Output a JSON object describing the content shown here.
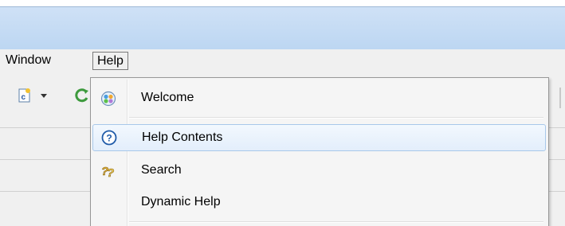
{
  "menubar": {
    "items": [
      {
        "label": "Window"
      },
      {
        "label": "Help"
      }
    ]
  },
  "help_menu": {
    "items": [
      {
        "label": "Welcome",
        "icon": "welcome-icon"
      },
      {
        "label": "Help Contents",
        "icon": "help-contents-icon",
        "highlighted": true
      },
      {
        "label": "Search",
        "icon": "search-icon"
      },
      {
        "label": "Dynamic Help",
        "icon": ""
      }
    ]
  },
  "toolbar": {
    "icons": [
      "new-c-file-icon",
      "dropdown-arrow-icon",
      "refresh-icon"
    ]
  },
  "colors": {
    "title_band": "#c4dbf4",
    "menu_bg": "#f0f0f0",
    "highlight_border": "#a8c8ea",
    "highlight_fill": "#e8f1fc",
    "help_blue": "#1e5aa8"
  }
}
